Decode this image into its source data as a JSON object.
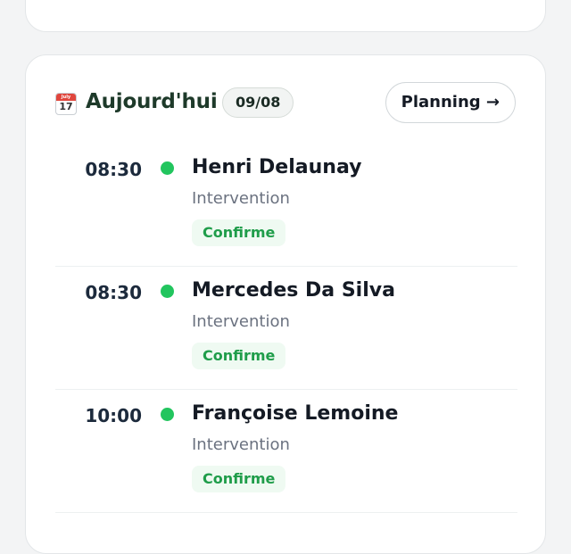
{
  "header": {
    "title": "Aujourd'hui",
    "date": "09/08",
    "planning_label": "Planning →",
    "calendar_month": "July",
    "calendar_day": "17"
  },
  "appointments": [
    {
      "time": "08:30",
      "name": "Henri Delaunay",
      "type": "Intervention",
      "status": "Confirme"
    },
    {
      "time": "08:30",
      "name": "Mercedes Da Silva",
      "type": "Intervention",
      "status": "Confirme"
    },
    {
      "time": "10:00",
      "name": "Françoise Lemoine",
      "type": "Intervention",
      "status": "Confirme"
    }
  ],
  "colors": {
    "status_dot": "#22c55e",
    "status_text": "#1f9d4a",
    "title": "#1e3a2a"
  }
}
